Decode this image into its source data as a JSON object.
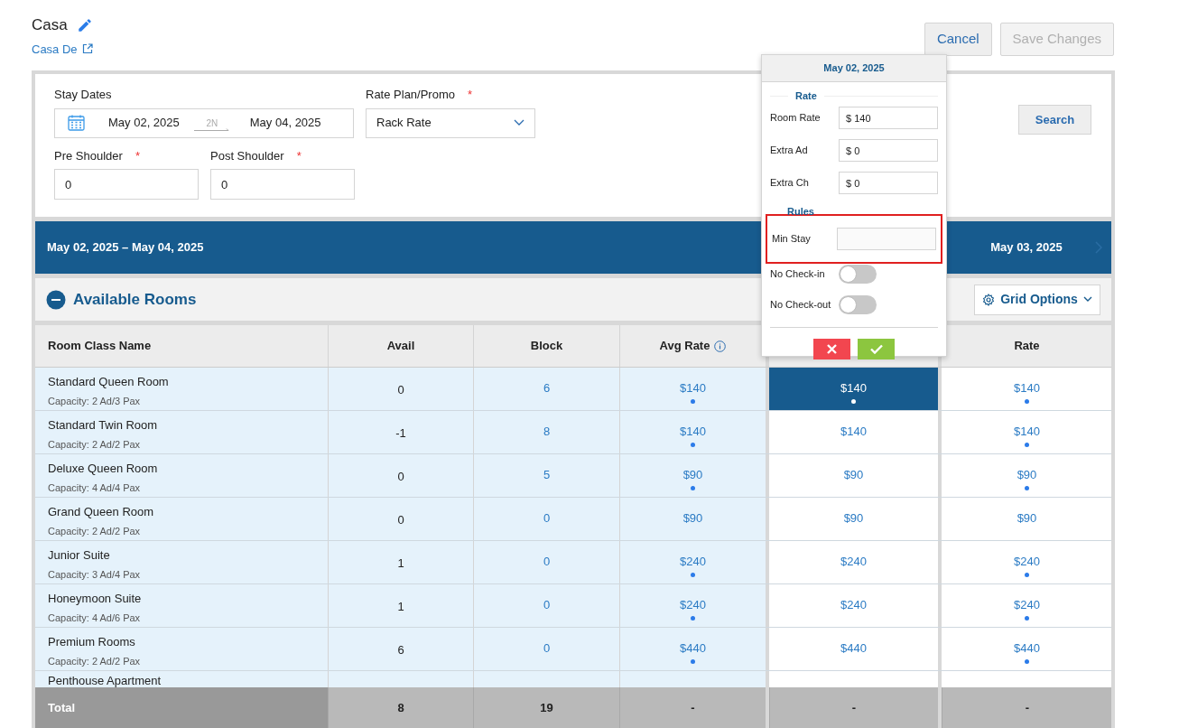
{
  "header": {
    "title": "Casa",
    "subtitle_link": "Casa De"
  },
  "actions": [
    {
      "label": "Cancel",
      "disabled": false
    },
    {
      "label": "Save Changes",
      "disabled": true
    }
  ],
  "filters": {
    "stay_dates": {
      "label": "Stay Dates",
      "from": "May 02, 2025",
      "nights": "2N",
      "to": "May 04, 2025"
    },
    "rate_plan": {
      "label": "Rate Plan/Promo",
      "required_mark": "*",
      "value": "Rack Rate"
    },
    "shoulders": [
      {
        "label": "Pre Shoulder",
        "required_mark": "*",
        "value": "0"
      },
      {
        "label": "Post Shoulder",
        "required_mark": "*",
        "value": "0"
      }
    ],
    "search_button": "Search"
  },
  "date_bar": {
    "range": "May 02, 2025 – May 04, 2025",
    "next_date": "May 03, 2025"
  },
  "section": {
    "title": "Available Rooms",
    "expanded": true,
    "grid_options": "Grid Options"
  },
  "table": {
    "columns": [
      "Room Class Name",
      "Avail",
      "Block",
      "Avg Rate",
      "",
      "Rate"
    ],
    "rows": [
      {
        "name": "Standard Queen Room",
        "capacity": "Capacity: 2 Ad/3 Pax",
        "avail": "0",
        "block": "6",
        "avg": {
          "text": "$140",
          "marked": true
        },
        "day1": {
          "text": "$140",
          "marked": true,
          "selected": true
        },
        "day2": {
          "text": "$140",
          "marked": true
        }
      },
      {
        "name": "Standard Twin Room",
        "capacity": "Capacity: 2 Ad/2 Pax",
        "avail": "-1",
        "block": "8",
        "avg": {
          "text": "$140",
          "marked": true
        },
        "day1": {
          "text": "$140",
          "marked": false,
          "selected": false
        },
        "day2": {
          "text": "$140",
          "marked": true
        }
      },
      {
        "name": "Deluxe Queen Room",
        "capacity": "Capacity: 4 Ad/4 Pax",
        "avail": "0",
        "block": "5",
        "avg": {
          "text": "$90",
          "marked": true
        },
        "day1": {
          "text": "$90",
          "marked": false,
          "selected": false
        },
        "day2": {
          "text": "$90",
          "marked": true
        }
      },
      {
        "name": "Grand Queen Room",
        "capacity": "Capacity: 2 Ad/2 Pax",
        "avail": "0",
        "block": "0",
        "avg": {
          "text": "$90",
          "marked": false
        },
        "day1": {
          "text": "$90",
          "marked": false,
          "selected": false
        },
        "day2": {
          "text": "$90",
          "marked": false
        }
      },
      {
        "name": "Junior Suite",
        "capacity": "Capacity: 3 Ad/4 Pax",
        "avail": "1",
        "block": "0",
        "avg": {
          "text": "$240",
          "marked": true
        },
        "day1": {
          "text": "$240",
          "marked": false,
          "selected": false
        },
        "day2": {
          "text": "$240",
          "marked": true
        }
      },
      {
        "name": "Honeymoon Suite",
        "capacity": "Capacity: 4 Ad/6 Pax",
        "avail": "1",
        "block": "0",
        "avg": {
          "text": "$240",
          "marked": true
        },
        "day1": {
          "text": "$240",
          "marked": false,
          "selected": false
        },
        "day2": {
          "text": "$240",
          "marked": true
        }
      },
      {
        "name": "Premium Rooms",
        "capacity": "Capacity: 2 Ad/2 Pax",
        "avail": "6",
        "block": "0",
        "avg": {
          "text": "$440",
          "marked": true
        },
        "day1": {
          "text": "$440",
          "marked": false,
          "selected": false
        },
        "day2": {
          "text": "$440",
          "marked": true
        }
      },
      {
        "name": "Penthouse Apartment"
      }
    ],
    "total": [
      "Total",
      "8",
      "19",
      "-",
      "-",
      "-"
    ]
  },
  "popup": {
    "date": "May 02, 2025",
    "rate_heading": "Rate",
    "rate_fields": [
      {
        "label": "Room Rate",
        "value": "$ 140"
      },
      {
        "label": "Extra Ad",
        "value": "$ 0"
      },
      {
        "label": "Extra Ch",
        "value": "$ 0"
      }
    ],
    "rules_heading": "Rules",
    "min_stay": {
      "label": "Min Stay",
      "highlighted": true
    },
    "toggles": [
      {
        "label": "No Check-in",
        "on": false
      },
      {
        "label": "No Check-out",
        "on": false
      }
    ]
  }
}
